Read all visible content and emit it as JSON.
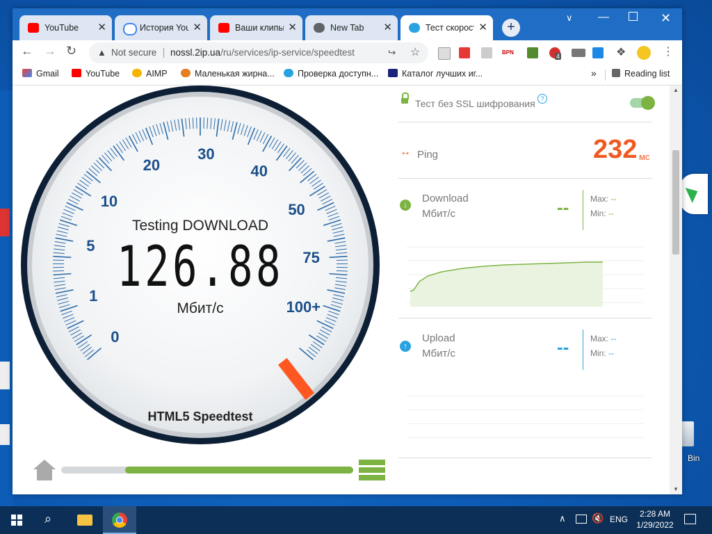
{
  "browser": {
    "tabs": [
      {
        "label": "YouTube",
        "icon": "youtube-icon",
        "active": false
      },
      {
        "label": "История You",
        "icon": "google-icon",
        "active": false
      },
      {
        "label": "Ваши клипы",
        "icon": "youtube-icon",
        "active": false
      },
      {
        "label": "New Tab",
        "icon": "chrome-icon",
        "active": false
      },
      {
        "label": "Тест скорост",
        "icon": "2ip-icon",
        "active": true
      }
    ],
    "security": "Not secure",
    "url_host": "nossl.2ip.ua",
    "url_path": "/ru/services/ip-service/speedtest",
    "extension_badge": "4",
    "bookmarks": [
      "Gmail",
      "YouTube",
      "AIMP",
      "Маленькая жирна...",
      "Проверка доступн...",
      "Каталог лучших иг..."
    ],
    "reading_list": "Reading list",
    "more_bookmarks": "»"
  },
  "gauge": {
    "status": "Testing DOWNLOAD",
    "value": "126.88",
    "unit": "Мбит/с",
    "brand": "HTML5 Speedtest",
    "ticks": [
      "0",
      "1",
      "5",
      "10",
      "20",
      "30",
      "40",
      "50",
      "75",
      "100+"
    ],
    "progress_fraction": 0.78
  },
  "panel": {
    "ssl_label": "Тест без SSL шифрования",
    "ssl_help": "?",
    "ping_label": "Ping",
    "ping_value": "232",
    "ping_unit": "мс",
    "download_label": "Download",
    "download_unit": "Мбит/с",
    "download_value": "--",
    "upload_label": "Upload",
    "upload_unit": "Мбит/с",
    "upload_value": "--",
    "max_label": "Max:",
    "min_label": "Min:",
    "dl_max": "--",
    "dl_min": "--",
    "ul_max": "--",
    "ul_min": "--"
  },
  "taskbar": {
    "lang": "ENG",
    "time": "2:28 AM",
    "date": "1/29/2022"
  },
  "desktop": {
    "recycle_label": "Bin"
  },
  "colors": {
    "accent_green": "#7cb342",
    "ping_orange": "#f05a22",
    "upload_blue": "#29a3e0",
    "gauge_blue": "#1b4f8a",
    "needle": "#ff5722"
  }
}
